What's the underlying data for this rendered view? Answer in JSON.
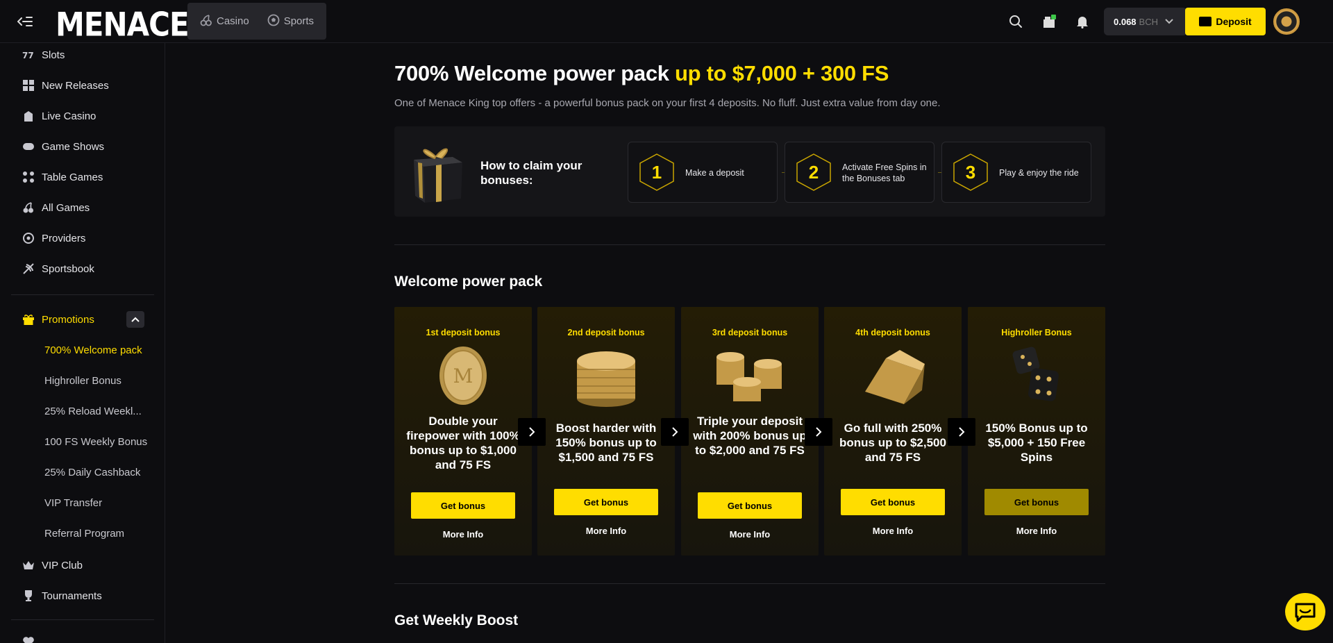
{
  "topbar": {
    "logo": "MENACE",
    "modes": [
      {
        "label": "Casino",
        "icon": "cherries-icon"
      },
      {
        "label": "Sports",
        "icon": "soccer-ball-icon"
      }
    ],
    "balance_amount": "0.068",
    "balance_currency": "BCH",
    "deposit_label": "Deposit"
  },
  "sidebar": {
    "items": [
      {
        "label": "Slots",
        "icon": "slots-icon"
      },
      {
        "label": "New Releases",
        "icon": "new-releases-icon"
      },
      {
        "label": "Live Casino",
        "icon": "live-casino-icon"
      },
      {
        "label": "Game Shows",
        "icon": "gamepad-icon"
      },
      {
        "label": "Table Games",
        "icon": "table-games-icon"
      },
      {
        "label": "All Games",
        "icon": "cherries-icon"
      },
      {
        "label": "Providers",
        "icon": "providers-icon"
      },
      {
        "label": "Sportsbook",
        "icon": "sportsbook-icon"
      }
    ],
    "promotions_label": "Promotions",
    "promotions_sub": [
      "700% Welcome pack",
      "Highroller Bonus",
      "25% Reload Weekl...",
      "100 FS Weekly Bonus",
      "25% Daily Cashback",
      "VIP Transfer",
      "Referral Program"
    ],
    "vip_label": "VIP Club",
    "tournaments_label": "Tournaments"
  },
  "hero": {
    "title": "700% Welcome power pack ",
    "title_highlight": "up to $7,000 + 300 FS",
    "subtitle": "One of Menace King top offers - a powerful bonus pack on your first 4 deposits. No fluff. Just extra value from day one."
  },
  "claim": {
    "label": "How to claim your bonuses:",
    "steps": [
      {
        "num": "1",
        "text": "Make a deposit"
      },
      {
        "num": "2",
        "text": "Activate Free Spins in the Bonuses tab"
      },
      {
        "num": "3",
        "text": "Play & enjoy the ride"
      }
    ]
  },
  "welcome_pack": {
    "title": "Welcome power pack",
    "cards": [
      {
        "title": "1st deposit bonus",
        "desc": "Double your firepower with 100% bonus up to $1,000 and 75 FS",
        "button": "Get bonus",
        "more": "More Info"
      },
      {
        "title": "2nd deposit bonus",
        "desc": "Boost harder with 150% bonus up to $1,500 and 75 FS",
        "button": "Get bonus",
        "more": "More Info"
      },
      {
        "title": "3rd deposit bonus",
        "desc": "Triple your deposit with 200% bonus up to $2,000 and 75 FS",
        "button": "Get bonus",
        "more": "More Info"
      },
      {
        "title": "4th deposit bonus",
        "desc": "Go full with 250% bonus up to $2,500 and 75 FS",
        "button": "Get bonus",
        "more": "More Info"
      },
      {
        "title": "Highroller Bonus",
        "desc": "150% Bonus up to $5,000 + 150 Free Spins",
        "button": "Get bonus",
        "more": "More Info"
      }
    ]
  },
  "weekly": {
    "title": "Get Weekly Boost"
  },
  "colors": {
    "accent": "#ffdd00",
    "background": "#0d0d10",
    "panel": "#151518"
  }
}
